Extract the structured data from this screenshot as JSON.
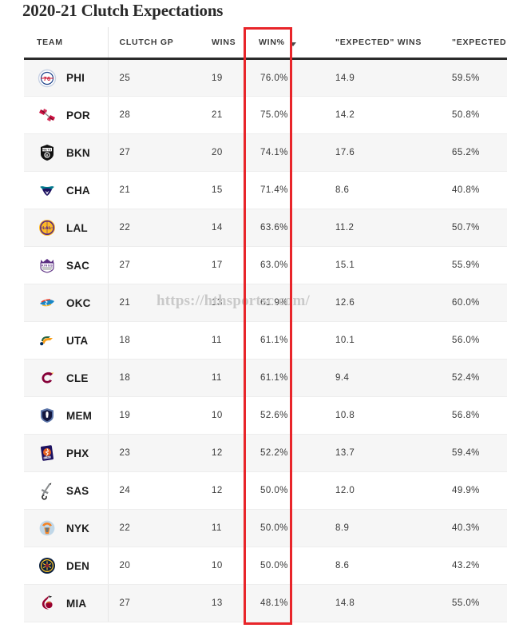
{
  "page_title": "2020-21 Clutch Expectations",
  "watermark": "https://hthsportsc.com/",
  "table": {
    "columns": [
      {
        "key": "team",
        "label": "TEAM"
      },
      {
        "key": "gp",
        "label": "CLUTCH GP"
      },
      {
        "key": "wins",
        "label": "WINS"
      },
      {
        "key": "winpct",
        "label": "WIN%"
      },
      {
        "key": "ewins",
        "label": "\"EXPECTED\" WINS"
      },
      {
        "key": "ewinpct",
        "label": "\"EXPECTED\" WIN%"
      }
    ],
    "sorted_column": "WIN%",
    "sort_direction": "descending",
    "sort_icon": "caret-down-icon",
    "highlight_color": "#e8252a",
    "rows": [
      {
        "team": "PHI",
        "logo": "sixers-logo",
        "gp": "25",
        "wins": "19",
        "winpct": "76.0%",
        "ewins": "14.9",
        "ewinpct": "59.5%"
      },
      {
        "team": "POR",
        "logo": "blazers-logo",
        "gp": "28",
        "wins": "21",
        "winpct": "75.0%",
        "ewins": "14.2",
        "ewinpct": "50.8%"
      },
      {
        "team": "BKN",
        "logo": "nets-logo",
        "gp": "27",
        "wins": "20",
        "winpct": "74.1%",
        "ewins": "17.6",
        "ewinpct": "65.2%"
      },
      {
        "team": "CHA",
        "logo": "hornets-logo",
        "gp": "21",
        "wins": "15",
        "winpct": "71.4%",
        "ewins": "8.6",
        "ewinpct": "40.8%"
      },
      {
        "team": "LAL",
        "logo": "lakers-logo",
        "gp": "22",
        "wins": "14",
        "winpct": "63.6%",
        "ewins": "11.2",
        "ewinpct": "50.7%"
      },
      {
        "team": "SAC",
        "logo": "kings-logo",
        "gp": "27",
        "wins": "17",
        "winpct": "63.0%",
        "ewins": "15.1",
        "ewinpct": "55.9%"
      },
      {
        "team": "OKC",
        "logo": "thunder-logo",
        "gp": "21",
        "wins": "13",
        "winpct": "61.9%",
        "ewins": "12.6",
        "ewinpct": "60.0%"
      },
      {
        "team": "UTA",
        "logo": "jazz-logo",
        "gp": "18",
        "wins": "11",
        "winpct": "61.1%",
        "ewins": "10.1",
        "ewinpct": "56.0%"
      },
      {
        "team": "CLE",
        "logo": "cavaliers-logo",
        "gp": "18",
        "wins": "11",
        "winpct": "61.1%",
        "ewins": "9.4",
        "ewinpct": "52.4%"
      },
      {
        "team": "MEM",
        "logo": "grizzlies-logo",
        "gp": "19",
        "wins": "10",
        "winpct": "52.6%",
        "ewins": "10.8",
        "ewinpct": "56.8%"
      },
      {
        "team": "PHX",
        "logo": "suns-logo",
        "gp": "23",
        "wins": "12",
        "winpct": "52.2%",
        "ewins": "13.7",
        "ewinpct": "59.4%"
      },
      {
        "team": "SAS",
        "logo": "spurs-logo",
        "gp": "24",
        "wins": "12",
        "winpct": "50.0%",
        "ewins": "12.0",
        "ewinpct": "49.9%"
      },
      {
        "team": "NYK",
        "logo": "knicks-logo",
        "gp": "22",
        "wins": "11",
        "winpct": "50.0%",
        "ewins": "8.9",
        "ewinpct": "40.3%"
      },
      {
        "team": "DEN",
        "logo": "nuggets-logo",
        "gp": "20",
        "wins": "10",
        "winpct": "50.0%",
        "ewins": "8.6",
        "ewinpct": "43.2%"
      },
      {
        "team": "MIA",
        "logo": "heat-logo",
        "gp": "27",
        "wins": "13",
        "winpct": "48.1%",
        "ewins": "14.8",
        "ewinpct": "55.0%"
      }
    ]
  }
}
